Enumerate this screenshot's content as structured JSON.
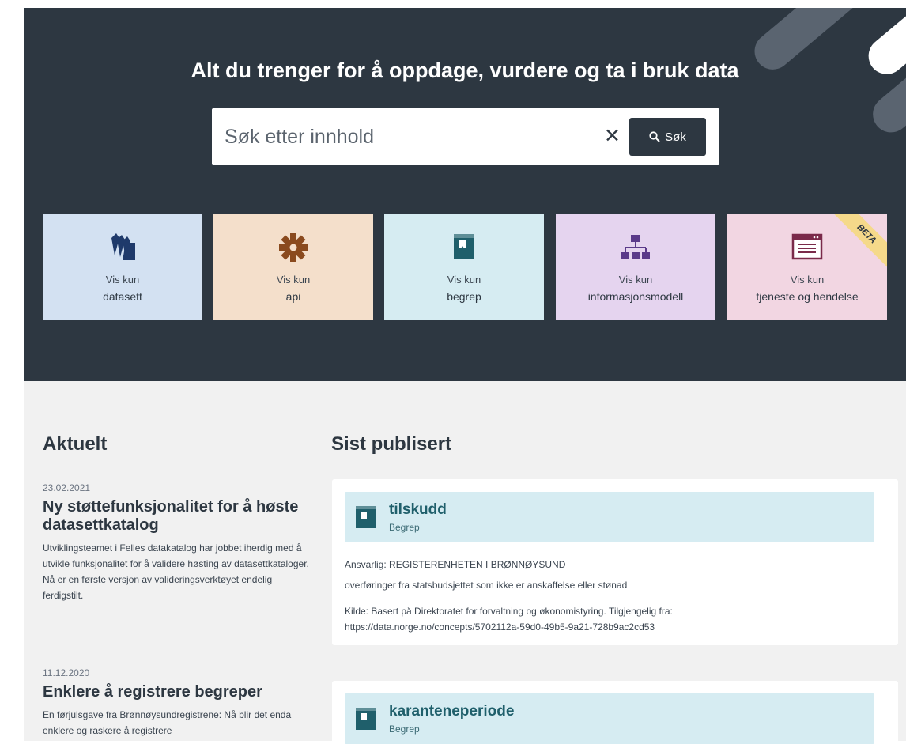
{
  "hero": {
    "title": "Alt du trenger for å oppdage, vurdere og ta i bruk data",
    "search": {
      "placeholder": "Søk etter innhold",
      "clear_label": "✕",
      "button_label": "Søk"
    }
  },
  "tiles": [
    {
      "line1": "Vis kun",
      "line2": "datasett",
      "bg": "#d3e1f2",
      "icon": "dataset-icon"
    },
    {
      "line1": "Vis kun",
      "line2": "api",
      "bg": "#f4dfcb",
      "icon": "api-gear-icon"
    },
    {
      "line1": "Vis kun",
      "line2": "begrep",
      "bg": "#d6ecf2",
      "icon": "concept-book-icon"
    },
    {
      "line1": "Vis kun",
      "line2": "informasjonsmodell",
      "bg": "#e5d4ef",
      "icon": "information-model-icon"
    },
    {
      "line1": "Vis kun",
      "line2": "tjeneste og hendelse",
      "bg": "#f2d6e2",
      "icon": "service-window-icon",
      "badge": "BETA"
    }
  ],
  "news": {
    "heading": "Aktuelt",
    "items": [
      {
        "date": "23.02.2021",
        "title": "Ny støttefunksjonalitet for å høste datasettkatalog",
        "body": "Utviklingsteamet i Felles datakatalog har jobbet iherdig med å utvikle funksjonalitet for å validere høsting av datasettkataloger. Nå er en første versjon av valideringsverktøyet endelig ferdigstilt."
      },
      {
        "date": "11.12.2020",
        "title": "Enklere å registrere begreper",
        "body": "En førjulsgave fra Brønnøysundregistrene: Nå blir det enda enklere og raskere å registrere"
      }
    ]
  },
  "latest": {
    "heading": "Sist publisert",
    "items": [
      {
        "title": "tilskudd",
        "type": "Begrep",
        "responsible": "Ansvarlig: REGISTERENHETEN I BRØNNØYSUND",
        "definition": "overføringer fra statsbudsjettet som ikke er anskaffelse eller stønad",
        "source_line1": "Kilde: Basert på Direktoratet for forvaltning og økonomistyring. Tilgjengelig fra:",
        "source_line2": "https://data.norge.no/concepts/5702112a-59d0-49b5-9a21-728b9ac2cd53"
      },
      {
        "title": "karanteneperiode",
        "type": "Begrep"
      }
    ]
  },
  "colors": {
    "hero_bg": "#2d3741",
    "content_bg": "#f1f1f1",
    "concept_accent": "#1f5f6b"
  }
}
